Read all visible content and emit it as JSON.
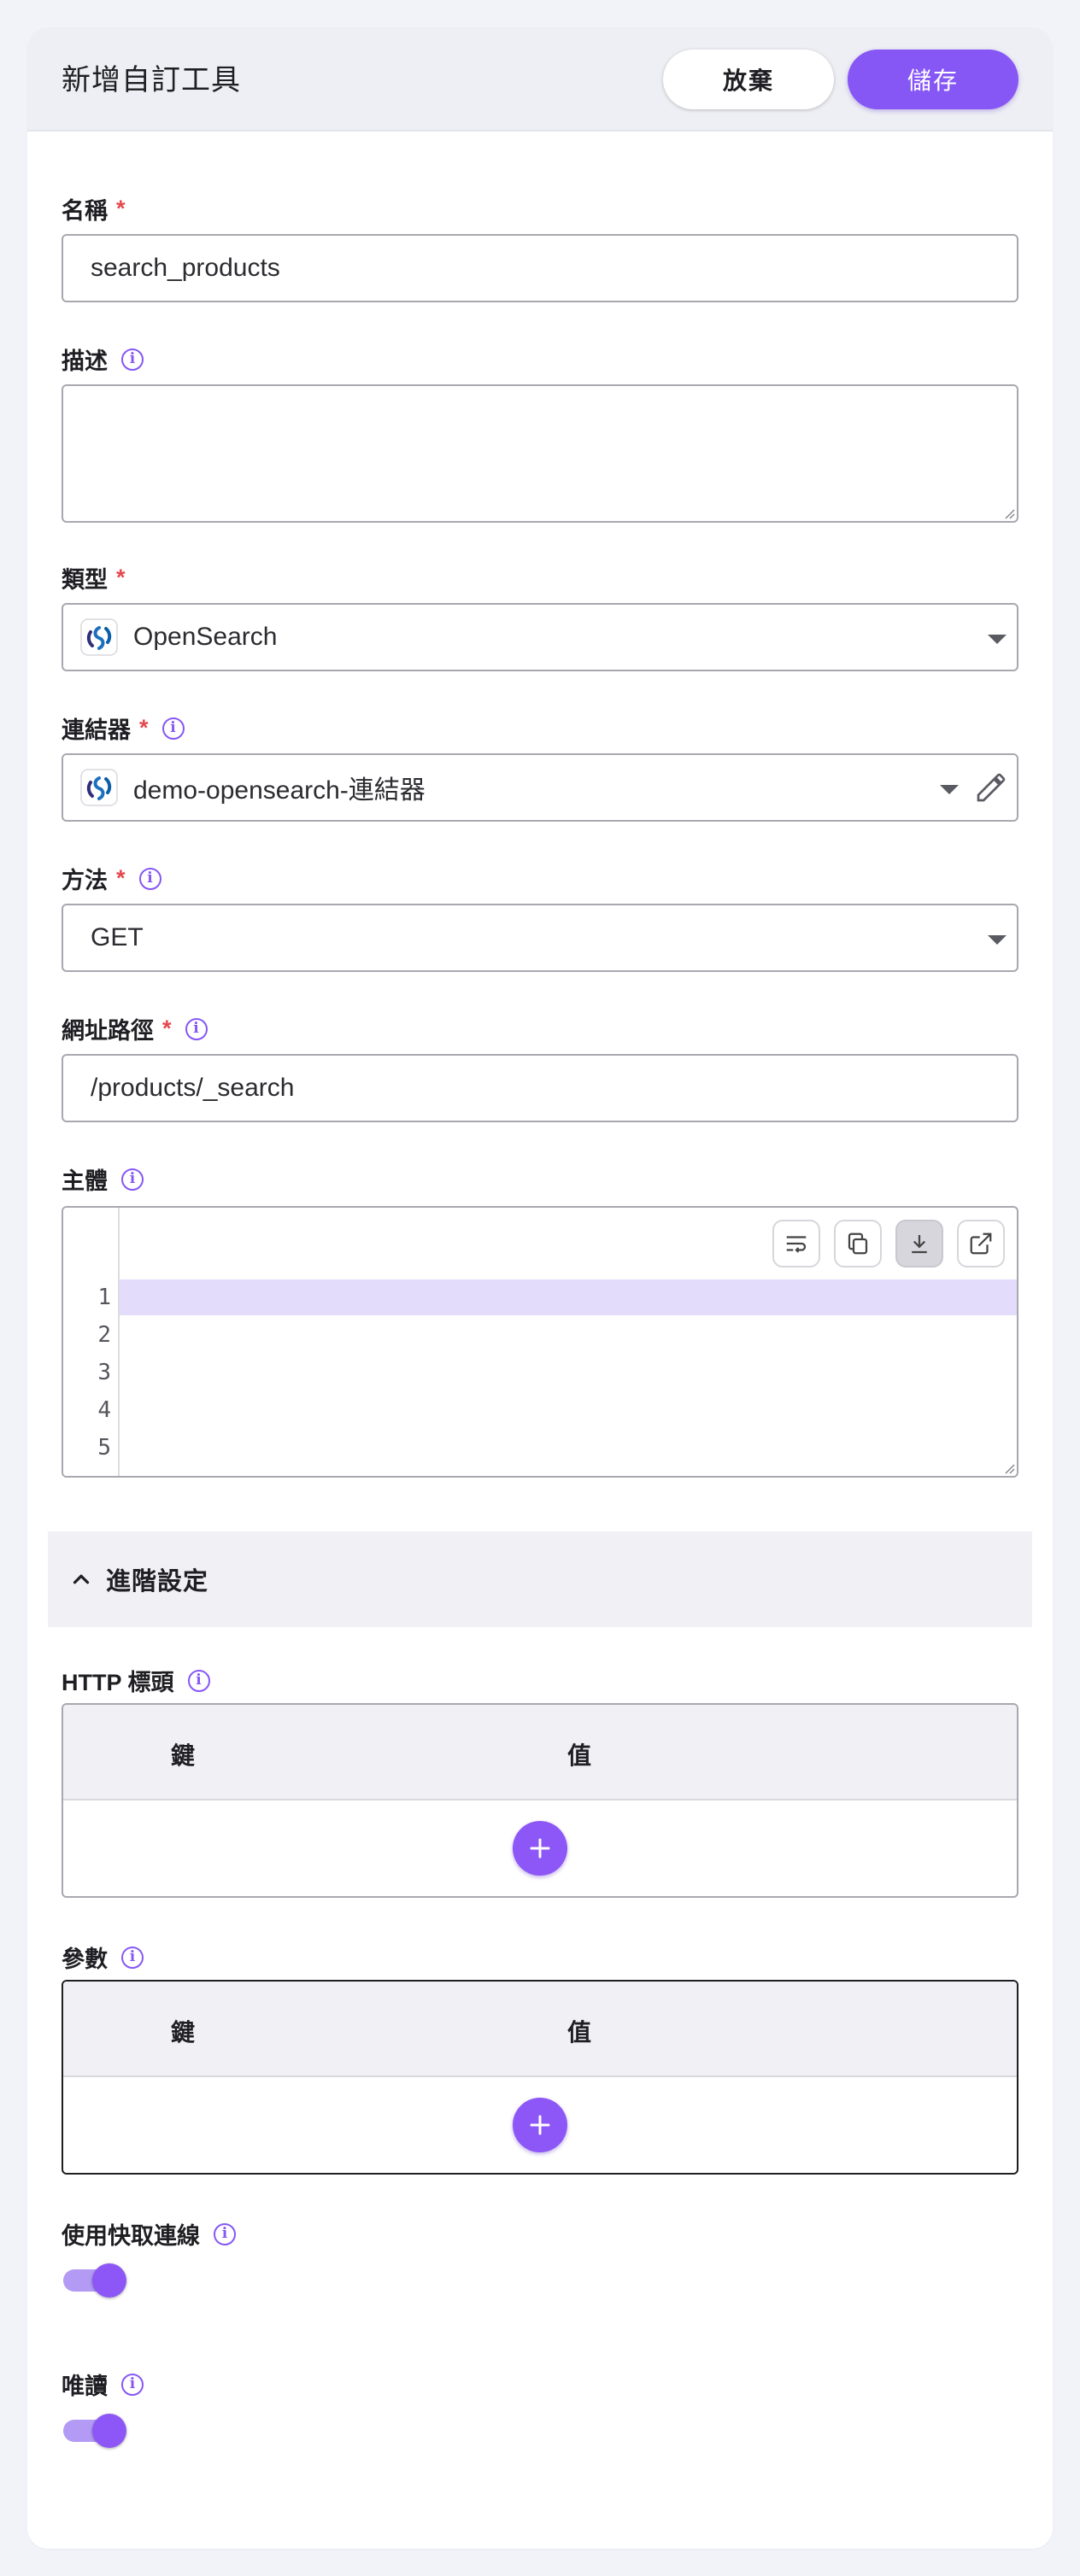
{
  "header": {
    "title": "新增自訂工具",
    "discard_label": "放棄",
    "save_label": "儲存"
  },
  "form": {
    "name": {
      "label": "名稱",
      "required": "*",
      "value": "search_products"
    },
    "description": {
      "label": "描述",
      "value": ""
    },
    "type": {
      "label": "類型",
      "required": "*",
      "value": "OpenSearch",
      "icon": "opensearch-logo"
    },
    "connector": {
      "label": "連結器",
      "required": "*",
      "value": "demo-opensearch-連結器",
      "icon": "opensearch-logo"
    },
    "method": {
      "label": "方法",
      "required": "*",
      "value": "GET"
    },
    "path": {
      "label": "網址路徑",
      "required": "*",
      "value": "/products/_search"
    },
    "body": {
      "label": "主體",
      "line_numbers": [
        "1",
        "2",
        "3",
        "4",
        "5"
      ],
      "toolbar": [
        "wrap-icon",
        "copy-icon",
        "download-icon",
        "open-external-icon"
      ]
    }
  },
  "advanced": {
    "label": "進階設定",
    "expanded": true,
    "headers": {
      "label": "HTTP 標頭",
      "key_col": "鍵",
      "value_col": "值"
    },
    "params": {
      "label": "參數",
      "key_col": "鍵",
      "value_col": "值"
    },
    "keep_alive": {
      "label": "使用快取連線",
      "on": true
    },
    "read_only": {
      "label": "唯讀",
      "on": true
    }
  },
  "colors": {
    "accent": "#8657f5",
    "required": "#e5484d",
    "editor_highlight": "#e4dcfb"
  }
}
